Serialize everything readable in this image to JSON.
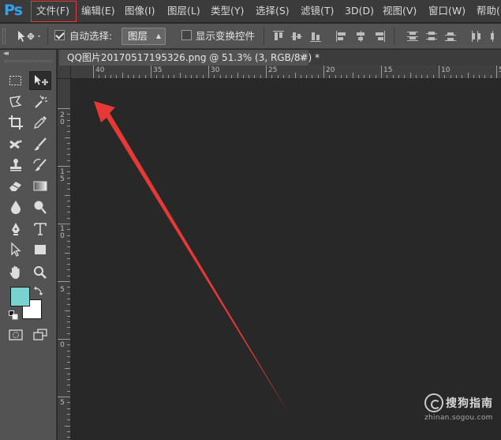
{
  "app": {
    "logo": "Ps"
  },
  "menubar": {
    "items": [
      "文件(F)",
      "编辑(E)",
      "图像(I)",
      "图层(L)",
      "类型(Y)",
      "选择(S)",
      "滤镜(T)",
      "3D(D)",
      "视图(V)",
      "窗口(W)",
      "帮助("
    ],
    "highlighted": "文件(F)",
    "highlight_color": "#e53935"
  },
  "options": {
    "auto_select_label": "自动选择:",
    "auto_select_checked": true,
    "layer_target": "图层",
    "show_transform_label": "显示变换控件",
    "show_transform_checked": false
  },
  "document": {
    "tab_title": "QQ图片20170517195326.png @ 51.3% (3, RGB/8#) *",
    "close_glyph": "×"
  },
  "rulers": {
    "top_labels": [
      "40",
      "35",
      "30",
      "25",
      "20",
      "15",
      "10",
      "5"
    ],
    "left_labels": [
      "2\n0",
      "1\n5",
      "1\n0",
      "5",
      "0",
      "5"
    ]
  },
  "colors": {
    "foreground": "#79d2cf",
    "background": "#ffffff",
    "canvas": "#282828",
    "annotation_arrow": "#e53935"
  },
  "tools": [
    "marquee-tool",
    "move-tool",
    "lasso-tool",
    "magic-wand-tool",
    "crop-tool",
    "eyedropper-tool",
    "healing-brush-tool",
    "brush-tool",
    "clone-stamp-tool",
    "history-brush-tool",
    "eraser-tool",
    "gradient-tool",
    "blur-tool",
    "dodge-tool",
    "pen-tool",
    "type-tool",
    "path-selection-tool",
    "rectangle-tool",
    "hand-tool",
    "zoom-tool",
    "quick-mask-tool",
    "screen-mode-tool"
  ],
  "watermark": {
    "name": "搜狗指南",
    "domain": "zhinan.sogou.com"
  }
}
